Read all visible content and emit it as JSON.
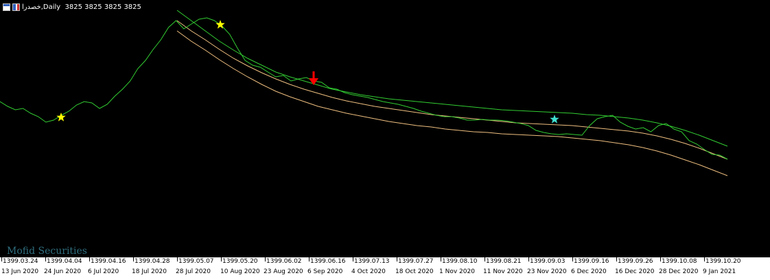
{
  "window": {
    "symbol": "خصدرا",
    "timeframe": "Daily",
    "ohlc": "3825 3825 3825 3825",
    "title_text": "خصدرا,Daily  3825 3825 3825 3825",
    "watermark": "Mofid Securities"
  },
  "colors": {
    "background": "#000000",
    "price_line": "#32cd32",
    "upper_band": "#32cd32",
    "lower_band": "#f0c080",
    "star_yellow": "#ffff00",
    "star_cyan": "#40e0d0",
    "arrow": "#ff0000"
  },
  "icons": [
    "chart-window-icon",
    "flag-icon",
    "yellow-star-icon",
    "cyan-star-icon",
    "red-down-arrow-icon"
  ],
  "chart_data": {
    "type": "line",
    "x_axis_jalali": [
      "1399.03.24",
      "1399.04.04",
      "1399.04.16",
      "1399.04.28",
      "1399.05.07",
      "1399.05.20",
      "1399.06.02",
      "1399.06.16",
      "1399.07.13",
      "1399.07.27",
      "1399.08.10",
      "1399.08.21",
      "1399.09.03",
      "1399.09.16",
      "1399.09.26",
      "1399.10.08",
      "1399.10.20"
    ],
    "x_axis_gregorian": [
      "13 Jun 2020",
      "24 Jun 2020",
      "6 Jul 2020",
      "18 Jul 2020",
      "28 Jul 2020",
      "10 Aug 2020",
      "23 Aug 2020",
      "6 Sep 2020",
      "4 Oct 2020",
      "18 Oct 2020",
      "1 Nov 2020",
      "11 Nov 2020",
      "23 Nov 2020",
      "6 Dec 2020",
      "16 Dec 2020",
      "28 Dec 2020",
      "9 Jan 2021"
    ],
    "series": [
      {
        "key": "price",
        "y": [
          148,
          155,
          160,
          158,
          165,
          170,
          178,
          175,
          168,
          162,
          153,
          148,
          150,
          158,
          152,
          140,
          130,
          118,
          100,
          88,
          72,
          58,
          40,
          30,
          42,
          35,
          28,
          26,
          30,
          38,
          50,
          70,
          88,
          95,
          98,
          105,
          112,
          110,
          118,
          115,
          113,
          118,
          120,
          128,
          130,
          135,
          138,
          140,
          142,
          145,
          148,
          150,
          152,
          155,
          158,
          162,
          165,
          168,
          170,
          170,
          172,
          175,
          175,
          174,
          175,
          175,
          176,
          178,
          180,
          183,
          190,
          193,
          195,
          196,
          195,
          196,
          197,
          183,
          173,
          170,
          168,
          178,
          184,
          188,
          186,
          192,
          183,
          180,
          188,
          192,
          205,
          210,
          218,
          225,
          226,
          232
        ]
      },
      {
        "key": "upper",
        "y": [
          15,
          30,
          45,
          60,
          73,
          85,
          95,
          105,
          112,
          118,
          124,
          130,
          134,
          138,
          141,
          144,
          146,
          148,
          150,
          152,
          154,
          156,
          158,
          160,
          161,
          162,
          163,
          164,
          165,
          167,
          168,
          170,
          172,
          175,
          179,
          184,
          190,
          197,
          205,
          213
        ]
      },
      {
        "key": "mid",
        "y": [
          30,
          45,
          58,
          72,
          85,
          96,
          106,
          115,
          123,
          130,
          136,
          142,
          147,
          151,
          155,
          158,
          161,
          164,
          167,
          169,
          171,
          173,
          175,
          177,
          179,
          180,
          181,
          182,
          183,
          185,
          187,
          189,
          191,
          194,
          198,
          203,
          209,
          216,
          224,
          232
        ]
      },
      {
        "key": "lower",
        "y": [
          45,
          60,
          73,
          87,
          100,
          112,
          123,
          133,
          141,
          148,
          155,
          160,
          165,
          169,
          173,
          177,
          180,
          183,
          185,
          188,
          190,
          192,
          193,
          195,
          196,
          197,
          198,
          199,
          201,
          203,
          205,
          208,
          211,
          215,
          220,
          226,
          233,
          240,
          248,
          256
        ]
      }
    ],
    "markers": [
      {
        "kind": "yellow-star",
        "x": "24 Jun 2020"
      },
      {
        "kind": "yellow-star",
        "x": "10 Aug 2020"
      },
      {
        "kind": "red-down-arrow",
        "x": "6 Sep 2020"
      },
      {
        "kind": "cyan-star",
        "x": "23 Nov 2020"
      }
    ]
  }
}
